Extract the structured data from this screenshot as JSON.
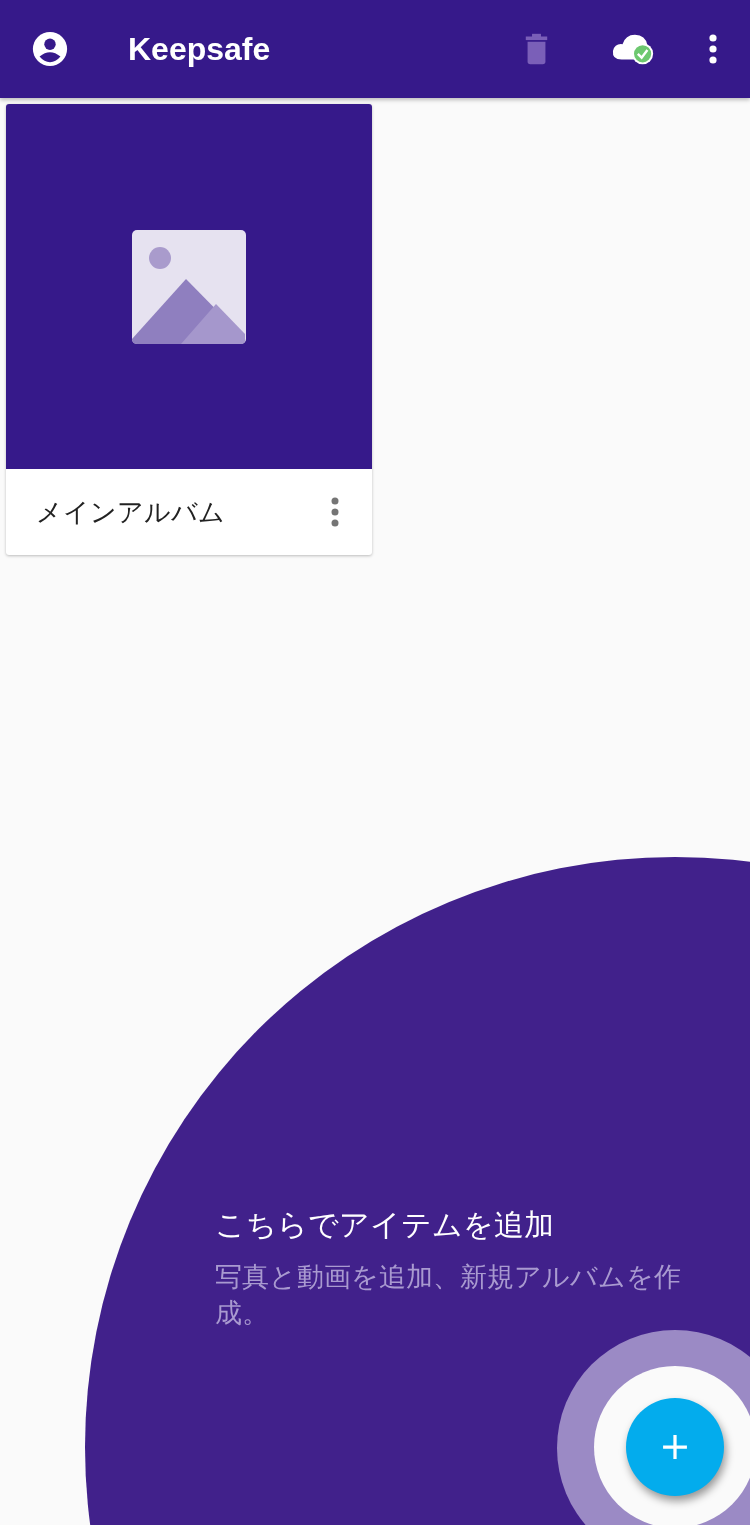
{
  "app_bar": {
    "title": "Keepsafe",
    "trash_disabled": true
  },
  "albums": [
    {
      "name": "メインアルバム"
    }
  ],
  "coach_mark": {
    "title": "こちらでアイテムを追加",
    "description": "写真と動画を追加、新規アルバムを作成。"
  }
}
